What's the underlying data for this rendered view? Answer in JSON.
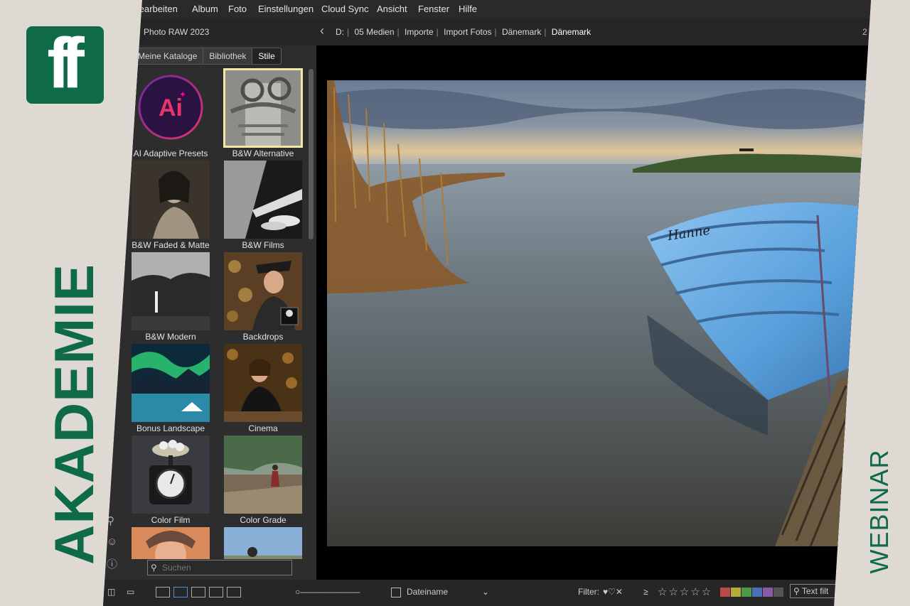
{
  "menu": [
    "Bearbeiten",
    "Album",
    "Foto",
    "Einstellungen",
    "Cloud Sync",
    "Ansicht",
    "Fenster",
    "Hilfe"
  ],
  "app_title": "Photo RAW 2023",
  "breadcrumb": [
    "D:",
    "05 Medien",
    "Importe",
    "Import Fotos",
    "Dänemark",
    "Dänemark"
  ],
  "page_indicator": "2",
  "tabs": [
    "Meine Kataloge",
    "Bibliothek",
    "Stile"
  ],
  "presets": [
    {
      "label": "AI Adaptive Presets"
    },
    {
      "label": "B&W Alternative"
    },
    {
      "label": "B&W Faded & Matte"
    },
    {
      "label": "B&W Films"
    },
    {
      "label": "B&W Modern"
    },
    {
      "label": "Backdrops"
    },
    {
      "label": "Bonus Landscape"
    },
    {
      "label": "Cinema"
    },
    {
      "label": "Color Film"
    },
    {
      "label": "Color Grade"
    }
  ],
  "ai_badge": "Ai",
  "search": {
    "placeholder": "Suchen"
  },
  "sort": {
    "label": "Dateiname"
  },
  "filter": {
    "label": "Filter:",
    "gte": "≥",
    "stars": "☆☆☆☆☆",
    "text_placeholder": "Text filt"
  },
  "boat_name": "Hanne",
  "color_labels": [
    "#b94a48",
    "#b5ab3a",
    "#4c9a4a",
    "#4a6fb5",
    "#8a5aa8",
    "#555555"
  ],
  "branding": {
    "logo": "ff",
    "vertical_left": "AKADEMIE",
    "vertical_right": "WEBINAR"
  }
}
